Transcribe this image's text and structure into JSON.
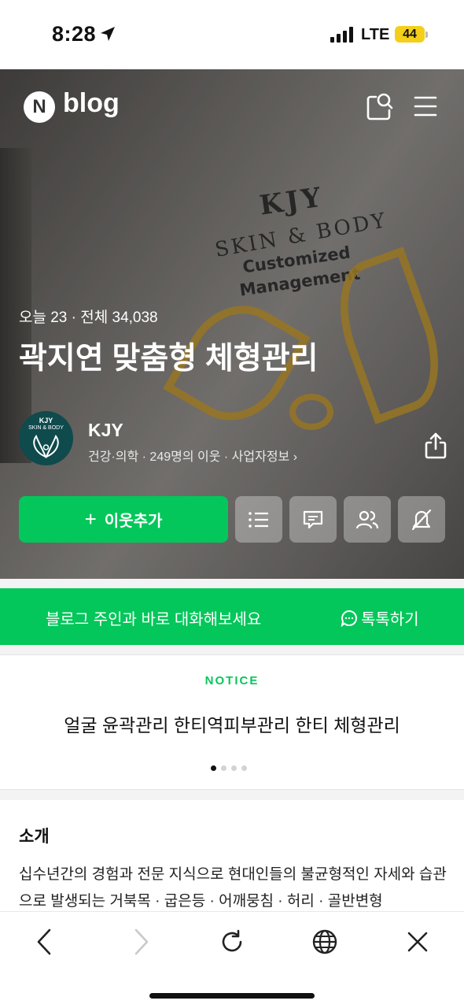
{
  "status_bar": {
    "time": "8:28",
    "network": "LTE",
    "battery": "44"
  },
  "header": {
    "logo_letter": "N",
    "logo_text": "blog"
  },
  "hero": {
    "sign_line1": "KJY",
    "sign_line2": "SKIN & BODY",
    "sign_line3": "Customized",
    "sign_line4": "Management"
  },
  "blog": {
    "visit_stats": "오늘 23 · 전체 34,038",
    "title": "곽지연 맞춤형 체형관리"
  },
  "author": {
    "name": "KJY",
    "meta": "건강·의학 · 249명의 이웃 · 사업자정보 ›",
    "avatar_text_top": "KJY",
    "avatar_text_bottom": "SKIN & BODY"
  },
  "actions": {
    "add_neighbor": "이웃추가"
  },
  "chat_banner": {
    "message": "블로그 주인과 바로 대화해보세요",
    "talk_label": "톡톡하기"
  },
  "notice": {
    "label": "NOTICE",
    "title": "얼굴 윤곽관리 한티역피부관리 한티 체형관리",
    "page_count": 4,
    "active_page": 1
  },
  "intro": {
    "heading": "소개",
    "body": "십수년간의 경험과 전문 지식으로 현대인들의 불균형적인 자세와 습관으로 발생되는 거북목 · 굽은등 · 어깨뭉침 · 허리 · 골반변형"
  },
  "colors": {
    "brand_green": "#03c75a",
    "battery_yellow": "#f4cf1a",
    "avatar_teal": "#0f4a4d",
    "gold": "#b98f2a"
  },
  "icons": [
    "location-arrow-icon",
    "signal-icon",
    "search-icon",
    "menu-icon",
    "share-icon",
    "list-icon",
    "guestbook-icon",
    "neighbors-icon",
    "mute-icon",
    "chat-bubble-icon",
    "back-icon",
    "forward-icon",
    "refresh-icon",
    "globe-icon",
    "close-icon"
  ]
}
